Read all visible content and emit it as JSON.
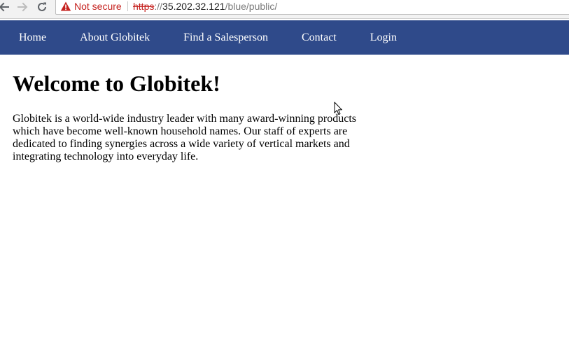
{
  "browser": {
    "security_label": "Not secure",
    "url": {
      "scheme": "https",
      "separator": "://",
      "host": "35.202.32.121",
      "path": "/blue/public/"
    },
    "icons": {
      "back": "back-arrow-icon",
      "forward": "forward-arrow-icon",
      "reload": "reload-icon",
      "security": "warning-triangle-icon"
    }
  },
  "nav": {
    "items": [
      {
        "label": "Home"
      },
      {
        "label": "About Globitek"
      },
      {
        "label": "Find a Salesperson"
      },
      {
        "label": "Contact"
      },
      {
        "label": "Login"
      }
    ]
  },
  "main": {
    "title": "Welcome to Globitek!",
    "intro": "Globitek is a world-wide industry leader with many award-winning products which have become well-known household names. Our staff of experts are dedicated to finding synergies across a wide variety of vertical markets and integrating technology into everyday life."
  },
  "colors": {
    "nav_background": "#2f4a8a",
    "nav_text": "#ffffff",
    "warning_red": "#c5221f",
    "page_background": "#ffffff"
  }
}
